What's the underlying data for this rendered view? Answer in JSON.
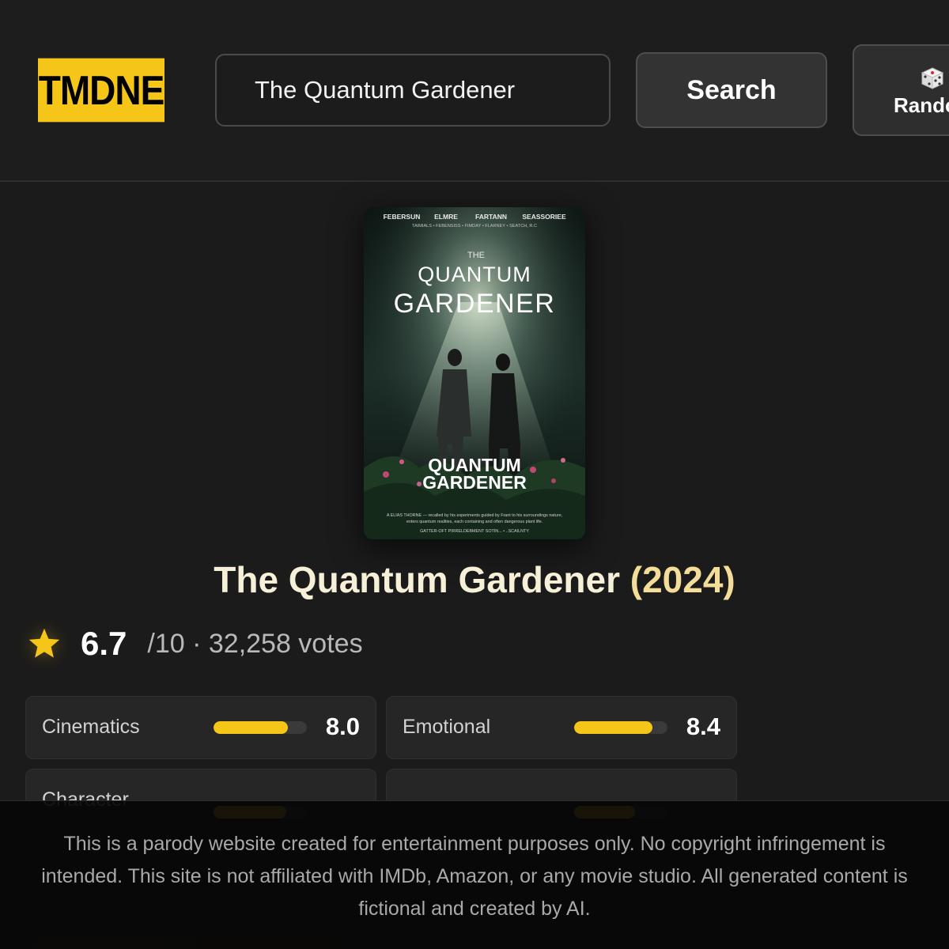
{
  "header": {
    "logo_text": "TMDNE",
    "search": {
      "value": "The Quantum Gardener",
      "placeholder": ""
    },
    "search_button_label": "Search",
    "random_button_label": "Rando",
    "accent_color": "#f5c518"
  },
  "poster": {
    "credits_top": [
      "FEBERSUN",
      "ELMRE",
      "FARTANN",
      "SEASSORIEE"
    ],
    "credits_sub": "TAIMIALS • FEBENSISS • FIMDAY • FLARNEY • SEATCH, R.C",
    "title_small": "THE",
    "title_line1": "QUANTUM",
    "title_line2": "GARDENER",
    "lower_title_line1": "QUANTUM",
    "lower_title_line2": "GARDENER",
    "tagline_1": "A ELIAS THORNE — recalled by his experiments guided by Frant to his surroundings nature,",
    "tagline_2": "enters quantum realities, each containing and often dangerous plant life.",
    "footer_credits": "GATTER-OFT   PIRRELDEBMENT   SOTIN...   •   ..SCAILNTY"
  },
  "movie": {
    "title_main": "The Quantum Gardener",
    "title_year": "(2024)"
  },
  "rating": {
    "score": "6.7",
    "suffix": "/10 · 32,258 votes",
    "icon": "star-icon"
  },
  "stats": [
    {
      "label": "Cinematics",
      "value": "8.0",
      "level": 0.8
    },
    {
      "label": "Emotional",
      "value": "8.4",
      "level": 0.84
    },
    {
      "label": "Character",
      "value": "",
      "level": 0.78
    },
    {
      "label": "",
      "value": "",
      "level": 0.65
    }
  ],
  "disclaimer": "This is a parody website created for entertainment purposes only. No copyright infringement is intended. This site is not affiliated with IMDb, Amazon, or any movie studio. All generated content is fictional and created by AI."
}
